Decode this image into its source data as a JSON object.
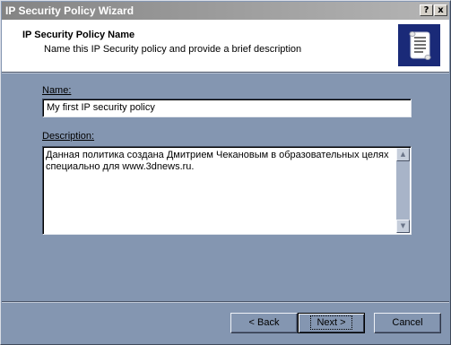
{
  "window": {
    "title": "IP Security Policy Wizard",
    "help_glyph": "?",
    "close_glyph": "x"
  },
  "header": {
    "title": "IP Security Policy Name",
    "subtitle": "Name this IP Security policy and provide a brief description",
    "icon": "scroll-document-icon"
  },
  "form": {
    "name_label": "Name:",
    "name_value": "My first IP security policy",
    "description_label": "Description:",
    "description_value": "Данная политика создана Дмитрием Чекановым в образовательных целях\nспециально для www.3dnews.ru."
  },
  "buttons": {
    "back": "< Back",
    "next": "Next >",
    "cancel": "Cancel"
  },
  "colors": {
    "dialog_bg": "#8496b1",
    "icon_bg": "#1a2a78",
    "header_bg": "#ffffff"
  }
}
